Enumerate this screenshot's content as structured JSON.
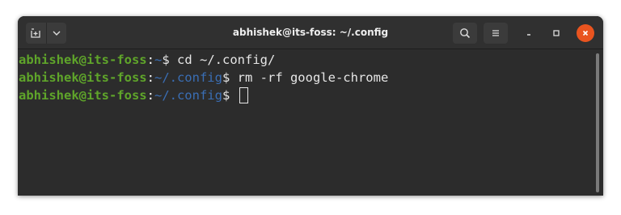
{
  "window": {
    "title": "abhishek@its-foss: ~/.config"
  },
  "toolbar": {
    "new_tab_icon": "new-tab-icon",
    "dropdown_icon": "chevron-down-icon",
    "search_icon": "search-icon",
    "menu_icon": "hamburger-menu-icon",
    "minimize_icon": "minimize-icon",
    "maximize_icon": "maximize-icon",
    "close_icon": "close-icon"
  },
  "terminal": {
    "lines": [
      {
        "user": "abhishek@its-foss",
        "colon": ":",
        "path": "~",
        "dollar": "$ ",
        "command": "cd ~/.config/"
      },
      {
        "user": "abhishek@its-foss",
        "colon": ":",
        "path": "~/.config",
        "dollar": "$ ",
        "command": "rm -rf google-chrome"
      },
      {
        "user": "abhishek@its-foss",
        "colon": ":",
        "path": "~/.config",
        "dollar": "$ ",
        "command": ""
      }
    ]
  },
  "colors": {
    "user": "#5fa52a",
    "path": "#3a6eb5",
    "background": "#2c2c2c",
    "close_button": "#e9541f"
  }
}
